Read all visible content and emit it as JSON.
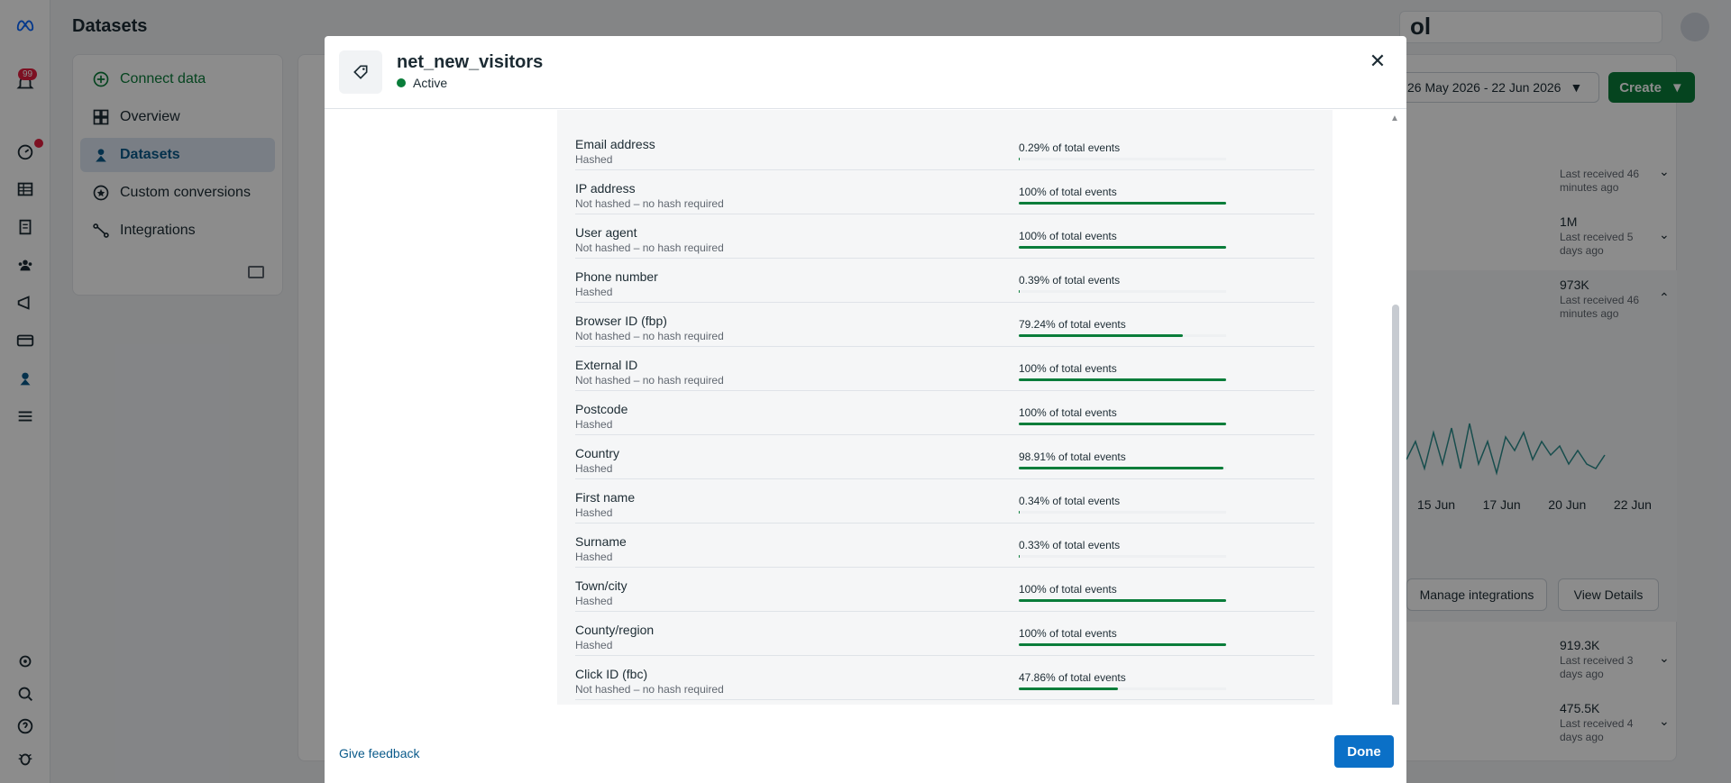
{
  "app": {
    "page_title": "Datasets",
    "notification_count": "99"
  },
  "bg_nav": {
    "items": [
      {
        "label": "Connect data",
        "icon": "plus-circle-icon"
      },
      {
        "label": "Overview",
        "icon": "grid-icon"
      },
      {
        "label": "Datasets",
        "icon": "datasets-icon"
      },
      {
        "label": "Custom conversions",
        "icon": "star-circle-icon"
      },
      {
        "label": "Integrations",
        "icon": "integrations-icon"
      }
    ]
  },
  "bg_toolbar": {
    "date_range": "26 May 2026 - 22 Jun 2026",
    "create_label": "Create",
    "search_partial": "ol"
  },
  "bg_rows": [
    {
      "value": "",
      "sub": "Last received 46 minutes ago"
    },
    {
      "value": "1M",
      "sub": "Last received 5 days ago"
    },
    {
      "value": "973K",
      "sub": "Last received 46 minutes ago"
    },
    {
      "value": "919.3K",
      "sub": "Last received 3 days ago"
    },
    {
      "value": "475.5K",
      "sub": "Last received 4 days ago"
    }
  ],
  "bg_chart": {
    "x_ticks": [
      "15 Jun",
      "17 Jun",
      "20 Jun",
      "22 Jun"
    ]
  },
  "bg_buttons": {
    "manage": "Manage integrations",
    "view": "View Details"
  },
  "modal": {
    "title": "net_new_visitors",
    "status": "Active",
    "feedback": "Give feedback",
    "done": "Done",
    "rows": [
      {
        "name": "Email address",
        "sub": "Hashed",
        "pct": "0.29% of total events",
        "coverage": 0.29
      },
      {
        "name": "IP address",
        "sub": "Not hashed – no hash required",
        "pct": "100% of total events",
        "coverage": 100
      },
      {
        "name": "User agent",
        "sub": "Not hashed – no hash required",
        "pct": "100% of total events",
        "coverage": 100
      },
      {
        "name": "Phone number",
        "sub": "Hashed",
        "pct": "0.39% of total events",
        "coverage": 0.39
      },
      {
        "name": "Browser ID (fbp)",
        "sub": "Not hashed – no hash required",
        "pct": "79.24% of total events",
        "coverage": 79.24
      },
      {
        "name": "External ID",
        "sub": "Not hashed – no hash required",
        "pct": "100% of total events",
        "coverage": 100
      },
      {
        "name": "Postcode",
        "sub": "Hashed",
        "pct": "100% of total events",
        "coverage": 100
      },
      {
        "name": "Country",
        "sub": "Hashed",
        "pct": "98.91% of total events",
        "coverage": 98.91
      },
      {
        "name": "First name",
        "sub": "Hashed",
        "pct": "0.34% of total events",
        "coverage": 0.34
      },
      {
        "name": "Surname",
        "sub": "Hashed",
        "pct": "0.33% of total events",
        "coverage": 0.33
      },
      {
        "name": "Town/city",
        "sub": "Hashed",
        "pct": "100% of total events",
        "coverage": 100
      },
      {
        "name": "County/region",
        "sub": "Hashed",
        "pct": "100% of total events",
        "coverage": 100
      },
      {
        "name": "Click ID (fbc)",
        "sub": "Not hashed – no hash required",
        "pct": "47.86% of total events",
        "coverage": 47.86
      }
    ]
  },
  "colors": {
    "accent_green": "#0a7d3a",
    "primary_blue": "#0b70c7"
  }
}
